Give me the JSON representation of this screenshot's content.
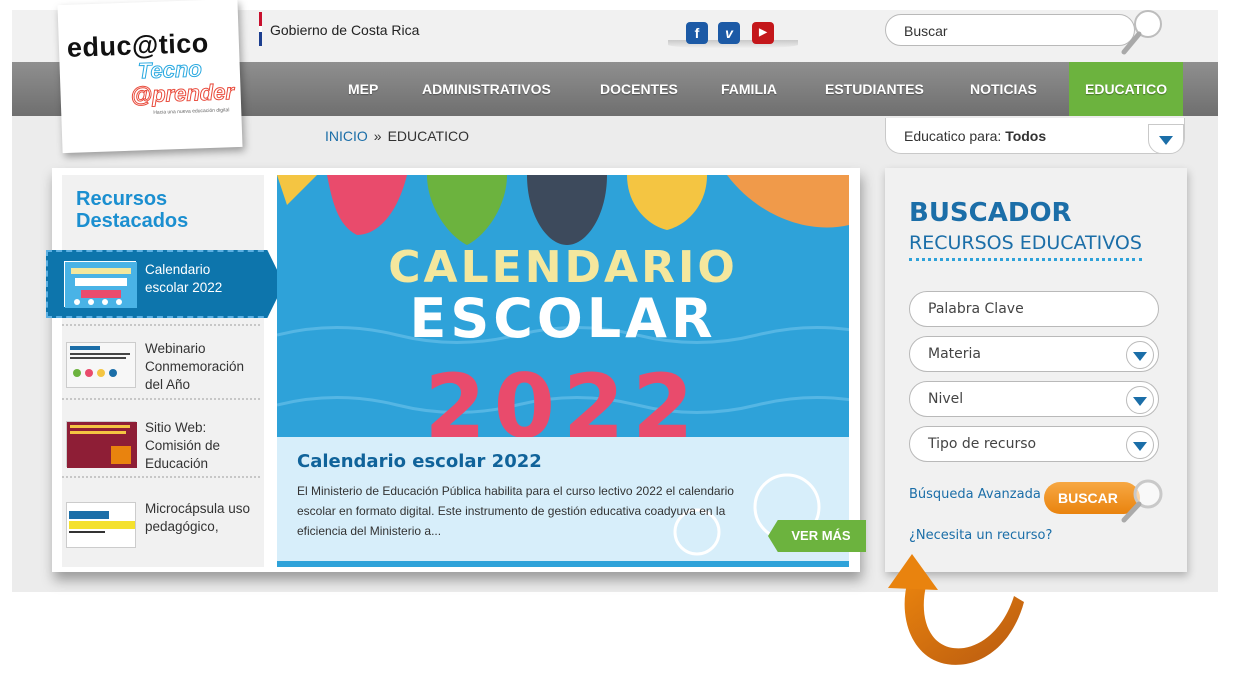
{
  "header": {
    "gov_text": "Gobierno de Costa Rica",
    "search_placeholder": "Buscar",
    "social": [
      "facebook-icon",
      "vimeo-icon",
      "youtube-icon"
    ]
  },
  "logo": {
    "line1": "educ@tico",
    "line2": "Tecno",
    "line3": "@prender",
    "tagline": "Hacia una nueva educación digital"
  },
  "nav": {
    "items": [
      {
        "label": "MEP"
      },
      {
        "label": "ADMINISTRATIVOS"
      },
      {
        "label": "DOCENTES"
      },
      {
        "label": "FAMILIA"
      },
      {
        "label": "ESTUDIANTES"
      },
      {
        "label": "NOTICIAS"
      },
      {
        "label": "EDUCATICO"
      }
    ],
    "active_color": "#6cb33e"
  },
  "breadcrumb": {
    "home": "INICIO",
    "sep": "»",
    "current": "EDUCATICO"
  },
  "audience": {
    "label": "Educatico para:",
    "value": "Todos"
  },
  "featured": {
    "title_line1": "Recursos",
    "title_line2": "Destacados",
    "items": [
      {
        "text_lines": [
          "Calendario",
          "escolar 2022"
        ]
      },
      {
        "text_lines": [
          "Webinario",
          "Conmemoración",
          "del Año"
        ]
      },
      {
        "text_lines": [
          "Sitio Web:",
          "Comisión de",
          "Educación"
        ]
      },
      {
        "text_lines": [
          "Microcápsula uso",
          "pedagógico,"
        ]
      }
    ]
  },
  "hero": {
    "line1": "CALENDARIO",
    "line2": "ESCOLAR",
    "line3": "2022",
    "caption_title": "Calendario escolar 2022",
    "caption_text": "El Ministerio de Educación Pública habilita para el curso lectivo 2022 el calendario escolar en formato digital. Este instrumento de gestión educativa coadyuva en la eficiencia del Ministerio a...",
    "more_label": "VER MÁS"
  },
  "buscador": {
    "title": "BUSCADOR",
    "subtitle": "RECURSOS EDUCATIVOS",
    "keyword_placeholder": "Palabra Clave",
    "materia": "Materia",
    "nivel": "Nivel",
    "tipo": "Tipo de recurso",
    "advanced_link": "Búsqueda Avanzada",
    "search_label": "BUSCAR",
    "need_link": "¿Necesita un recurso?"
  },
  "colors": {
    "brand_blue": "#1b6ea8",
    "accent_green": "#6cb33e",
    "accent_orange": "#e9830e"
  }
}
